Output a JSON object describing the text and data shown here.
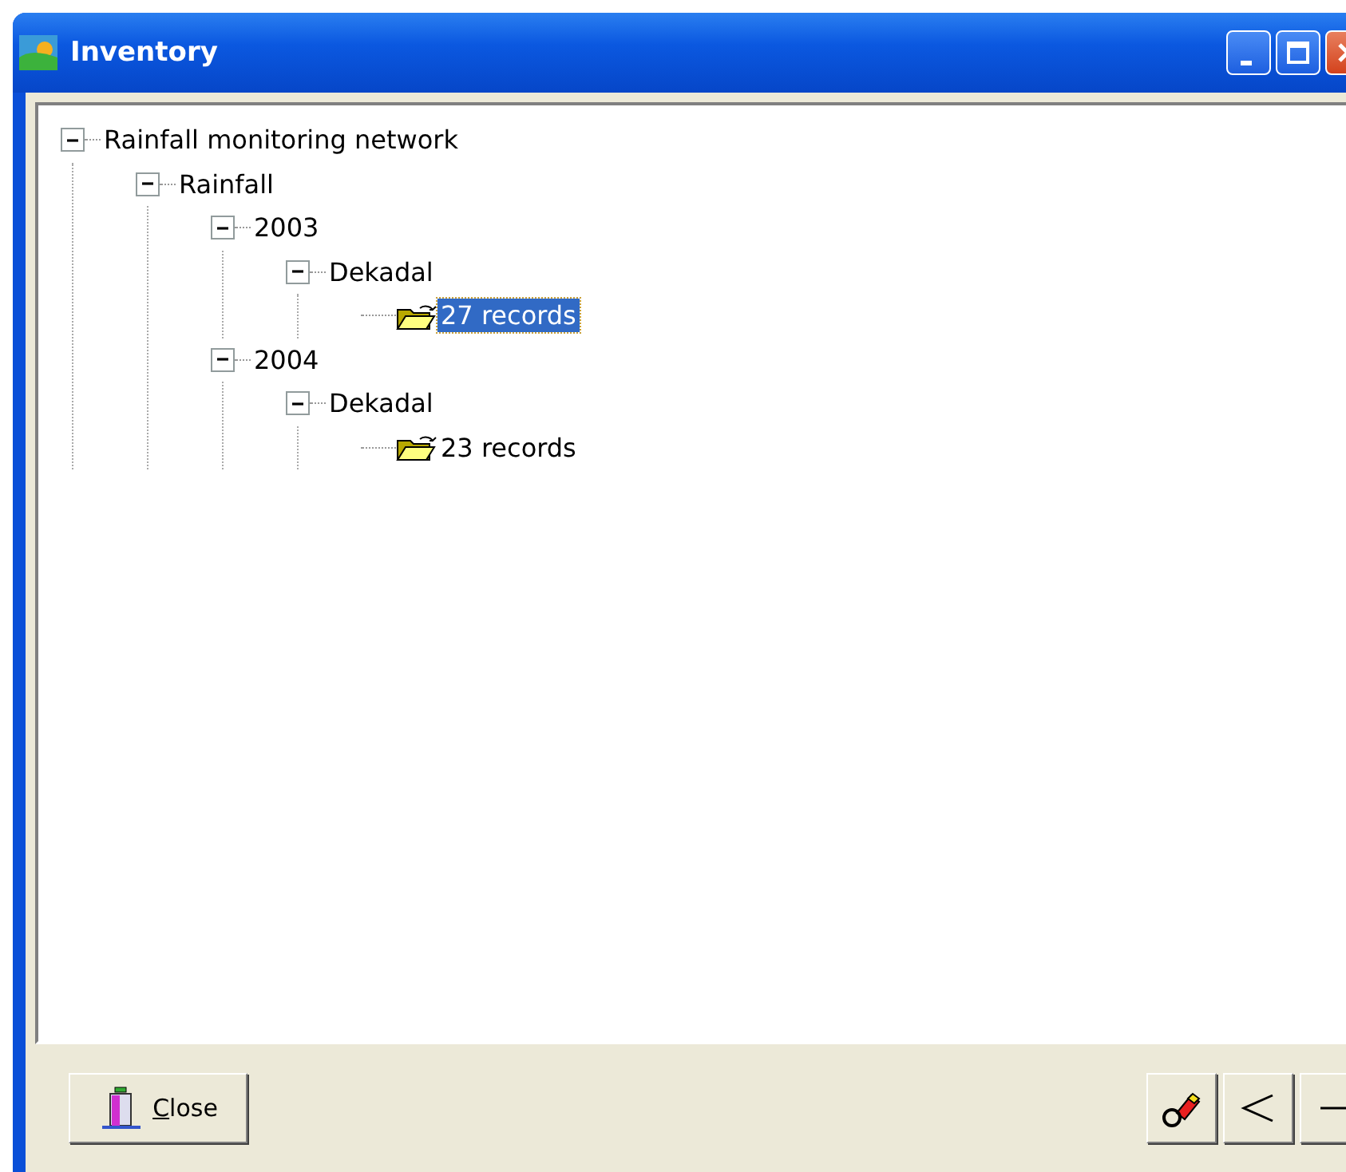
{
  "window": {
    "title": "Inventory"
  },
  "tree": [
    {
      "kind": "group",
      "label": "Rainfall monitoring network",
      "expanded": true,
      "selected": false,
      "children": [
        {
          "kind": "group",
          "label": "Rainfall",
          "expanded": true,
          "selected": false,
          "children": [
            {
              "kind": "group",
              "label": "2003",
              "expanded": true,
              "selected": false,
              "children": [
                {
                  "kind": "group",
                  "label": "Dekadal",
                  "expanded": true,
                  "selected": false,
                  "children": [
                    {
                      "kind": "records",
                      "label": "27 records",
                      "selected": true
                    }
                  ]
                }
              ]
            },
            {
              "kind": "group",
              "label": "2004",
              "expanded": true,
              "selected": false,
              "children": [
                {
                  "kind": "group",
                  "label": "Dekadal",
                  "expanded": true,
                  "selected": false,
                  "children": [
                    {
                      "kind": "records",
                      "label": "23 records",
                      "selected": false
                    }
                  ]
                }
              ]
            }
          ]
        }
      ]
    }
  ],
  "buttons": {
    "close": "Close"
  }
}
